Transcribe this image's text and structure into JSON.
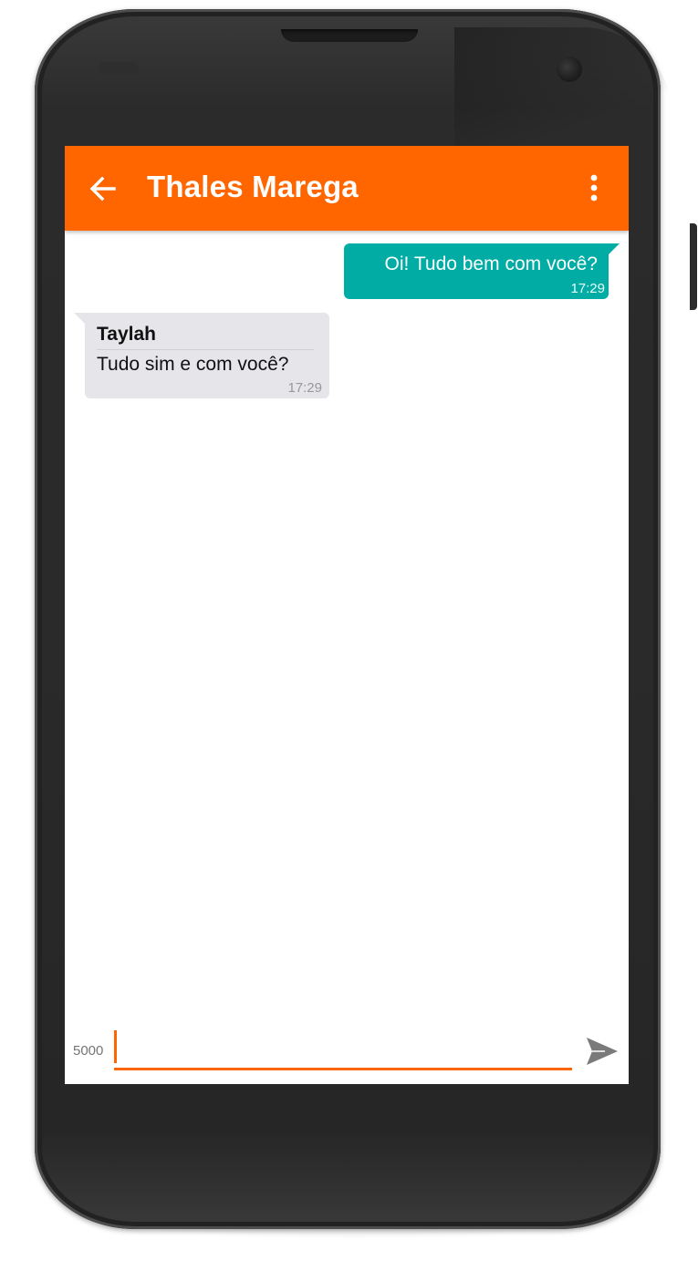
{
  "app_bar": {
    "title": "Thales Marega",
    "back_icon": "arrow-left-icon",
    "menu_icon": "more-vertical-icon",
    "color": "#ff6600"
  },
  "messages": [
    {
      "direction": "outgoing",
      "text": "Oi! Tudo bem com você?",
      "time": "17:29",
      "color": "#00aca4"
    },
    {
      "direction": "incoming",
      "sender": "Taylah",
      "text": "Tudo sim e com você?",
      "time": "17:29",
      "color": "#e5e5ea"
    }
  ],
  "composer": {
    "char_count": "5000",
    "value": "",
    "send_icon": "send-icon"
  }
}
